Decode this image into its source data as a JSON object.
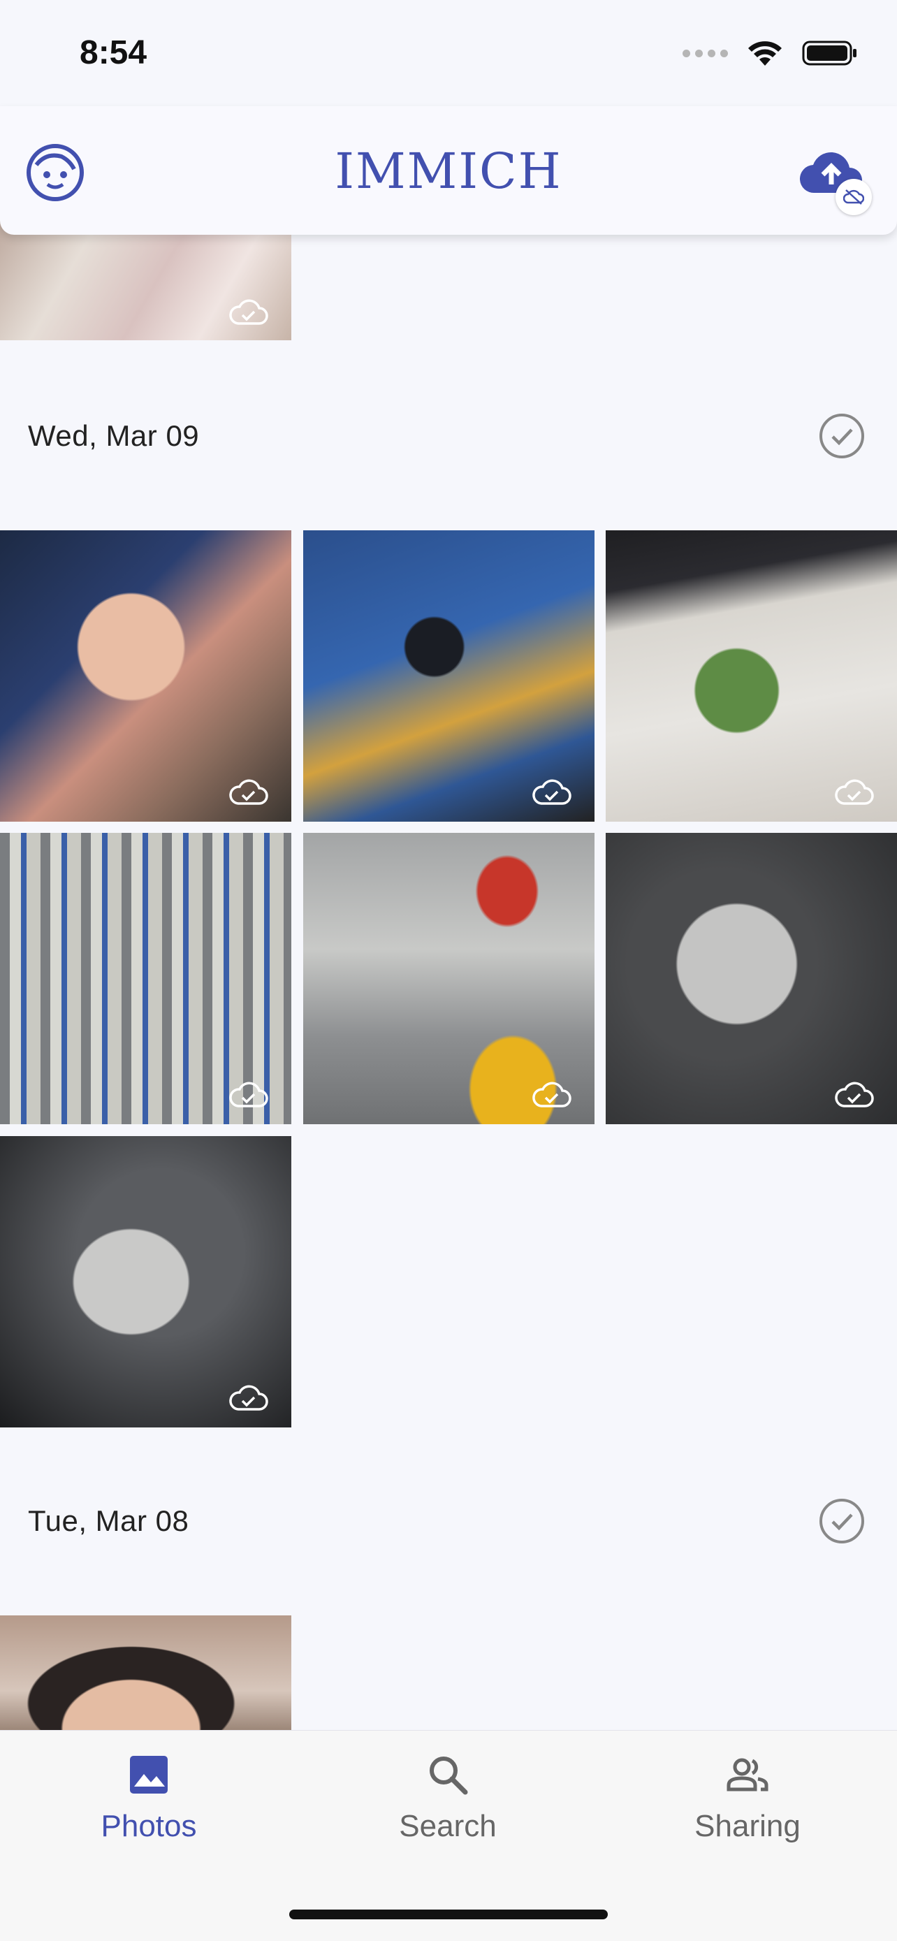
{
  "status_bar": {
    "time": "8:54"
  },
  "app_bar": {
    "title": "IMMICH"
  },
  "sections": [
    {
      "date": "Wed, Mar 09"
    },
    {
      "date": "Tue, Mar 08"
    }
  ],
  "bottom_nav": {
    "items": [
      {
        "label": "Photos",
        "icon": "photo-icon",
        "active": true
      },
      {
        "label": "Search",
        "icon": "search-icon",
        "active": false
      },
      {
        "label": "Sharing",
        "icon": "people-icon",
        "active": false
      }
    ]
  },
  "colors": {
    "accent": "#4250af",
    "background": "#f6f7fc",
    "inactive": "#666666"
  }
}
